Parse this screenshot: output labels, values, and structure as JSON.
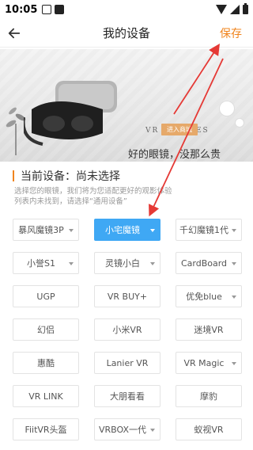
{
  "status": {
    "time": "10:05"
  },
  "header": {
    "title": "我的设备",
    "save_label": "保存"
  },
  "banner": {
    "en_text": "VR GLASSES",
    "cn_text": "好的眼镜，没那么贵",
    "button_label": "进入商城"
  },
  "current": {
    "title": "当前设备：尚未选择",
    "desc_line1": "选择您的眼镜，我们将为您适配更好的观影体验",
    "desc_line2": "列表内未找到，请选择“通用设备”"
  },
  "devices": [
    {
      "label": "暴风魔镜3P",
      "dropdown": true,
      "selected": false
    },
    {
      "label": "小宅魔镜",
      "dropdown": true,
      "selected": true
    },
    {
      "label": "千幻魔镜1代",
      "dropdown": true,
      "selected": false
    },
    {
      "label": "小誉S1",
      "dropdown": true,
      "selected": false
    },
    {
      "label": "灵镜小白",
      "dropdown": true,
      "selected": false
    },
    {
      "label": "CardBoard",
      "dropdown": true,
      "selected": false
    },
    {
      "label": "UGP",
      "dropdown": false,
      "selected": false
    },
    {
      "label": "VR BUY+",
      "dropdown": false,
      "selected": false
    },
    {
      "label": "优免blue",
      "dropdown": true,
      "selected": false
    },
    {
      "label": "幻侣",
      "dropdown": false,
      "selected": false
    },
    {
      "label": "小米VR",
      "dropdown": false,
      "selected": false
    },
    {
      "label": "迷境VR",
      "dropdown": false,
      "selected": false
    },
    {
      "label": "惠酷",
      "dropdown": false,
      "selected": false
    },
    {
      "label": "Lanier VR",
      "dropdown": false,
      "selected": false
    },
    {
      "label": "VR Magic",
      "dropdown": true,
      "selected": false
    },
    {
      "label": "VR LINK",
      "dropdown": false,
      "selected": false
    },
    {
      "label": "大朋看看",
      "dropdown": false,
      "selected": false
    },
    {
      "label": "摩豹",
      "dropdown": false,
      "selected": false
    },
    {
      "label": "FiitVR头盔",
      "dropdown": false,
      "selected": false
    },
    {
      "label": "VRBOX一代",
      "dropdown": true,
      "selected": false
    },
    {
      "label": "蚁视VR",
      "dropdown": false,
      "selected": false
    }
  ],
  "colors": {
    "accent": "#f0841d",
    "selected": "#3fa8f4",
    "annotation": "#e53935"
  }
}
